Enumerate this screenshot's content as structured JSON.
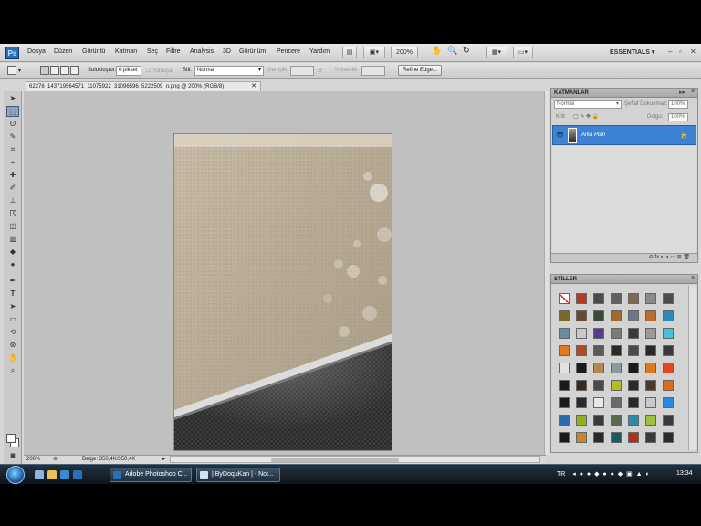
{
  "app": {
    "logo": "Ps",
    "essentials": "ESSENTIALS"
  },
  "menu": [
    "Dosya",
    "Düzen",
    "Görüntü",
    "Katman",
    "Seç",
    "Filtre",
    "Analysis",
    "3D",
    "Görünüm",
    "Pencere",
    "Yardım"
  ],
  "menubar_controls": {
    "zoom": "200%"
  },
  "options": {
    "feather_label": "Sulukluştur:",
    "feather_value": "0 piksel",
    "antialias_label": "Yumuşat",
    "style_label": "Stil:",
    "style_value": "Normal",
    "width_label": "Genişlik:",
    "height_label": "Yükseklik:",
    "refine_button": "Refine Edge..."
  },
  "document": {
    "tab_title": "62276_143719564571_11075922_31096596_5222509_n.png @ 200% (RGB/8)",
    "zoom_status": "200%",
    "doc_info": "Belge: 350,4K/350,4K"
  },
  "layers_panel": {
    "title": "KATMANLAR",
    "blend_mode": "Normal",
    "opacity_label": "Şeffaf Dokunmaz:",
    "opacity_value": "100%",
    "lock_label": "Kilit:",
    "fill_label": "Dolgu:",
    "fill_value": "100%",
    "layer_name": "Arka Plan"
  },
  "styles_panel": {
    "title": "STİLLER"
  },
  "style_colors": [
    "#ffffff",
    "#b33a1c",
    "#4a4a4a",
    "#5d6060",
    "#7d6a55",
    "#8a8a8a",
    "#4a4a4a",
    "#7a6a2a",
    "#6a4a2a",
    "#3a4a3a",
    "#a06a2a",
    "#6a7a8a",
    "#c06a2a",
    "#2a8ac0",
    "#6a8aa0",
    "#c8c8c8",
    "#5a3a8a",
    "#7a7a7a",
    "#3a3a3a",
    "#9a9a9a",
    "#4ac0e0",
    "#e07a20",
    "#b04a20",
    "#5a5a5a",
    "#2a2a2a",
    "#4a4a4a",
    "#2a2a2a",
    "#3a3a3a",
    "#e0e0e0",
    "#1a1a1a",
    "#b08a50",
    "#8a9aa0",
    "#1a1a1a",
    "#e07a20",
    "#e04a20",
    "#1a1a1a",
    "#3a2a1a",
    "#4a4a4a",
    "#b0c020",
    "#2a2a2a",
    "#4a3a2a",
    "#e06a10",
    "#1a1a1a",
    "#2a2a2a",
    "#e8e8e8",
    "#6a6a6a",
    "#2a2a2a",
    "#c8c8c8",
    "#2a8ae0",
    "#2a6ab0",
    "#90b020",
    "#3a3a3a",
    "#5a6a50",
    "#2a8ab0",
    "#a0c040",
    "#3a3a3a",
    "#1a1a1a",
    "#c08a2a",
    "#2a2a2a",
    "#1a5a5a",
    "#b03020",
    "#3a3a3a",
    "#2a2a2a"
  ],
  "taskbar": {
    "photoshop_task": "Adobe Photoshop C...",
    "notepad_task": "| ByDoquKan | - Not...",
    "lang": "TR",
    "time": "13:34"
  }
}
